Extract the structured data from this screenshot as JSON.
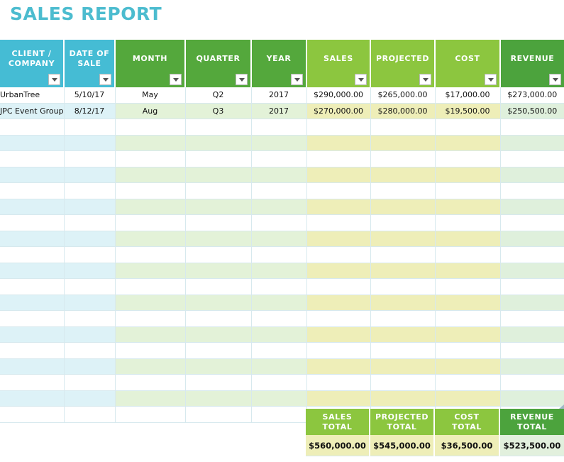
{
  "title": "SALES REPORT",
  "accent_color": "#4cbccf",
  "table": {
    "columns": [
      {
        "label": "CLIENT /\nCOMPANY",
        "line1": "CLIENT /",
        "line2": "COMPANY",
        "color": "#45bcd4"
      },
      {
        "label": "DATE OF\nSALE",
        "line1": "DATE OF",
        "line2": "SALE",
        "color": "#45bcd4"
      },
      {
        "label": "MONTH",
        "line1": "MONTH",
        "line2": "",
        "color": "#54a83c"
      },
      {
        "label": "QUARTER",
        "line1": "QUARTER",
        "line2": "",
        "color": "#54a83c"
      },
      {
        "label": "YEAR",
        "line1": "YEAR",
        "line2": "",
        "color": "#54a83c"
      },
      {
        "label": "SALES",
        "line1": "SALES",
        "line2": "",
        "color": "#8cc63f"
      },
      {
        "label": "PROJECTED",
        "line1": "PROJECTED",
        "line2": "",
        "color": "#8cc63f"
      },
      {
        "label": "COST",
        "line1": "COST",
        "line2": "",
        "color": "#8cc63f"
      },
      {
        "label": "REVENUE",
        "line1": "REVENUE",
        "line2": "",
        "color": "#4ca33d"
      }
    ],
    "filter_icon": "chevron-down-icon",
    "rows": [
      {
        "client": "UrbanTree",
        "date": "5/10/17",
        "month": "May",
        "quarter": "Q2",
        "year": "2017",
        "sales": "$290,000.00",
        "projected": "$265,000.00",
        "cost": "$17,000.00",
        "revenue": "$273,000.00"
      },
      {
        "client": "JPC Event Group",
        "date": "8/12/17",
        "month": "Aug",
        "quarter": "Q3",
        "year": "2017",
        "sales": "$270,000.00",
        "projected": "$280,000.00",
        "cost": "$19,500.00",
        "revenue": "$250,500.00"
      },
      {
        "client": "",
        "date": "",
        "month": "",
        "quarter": "",
        "year": "",
        "sales": "",
        "projected": "",
        "cost": "",
        "revenue": ""
      },
      {
        "client": "",
        "date": "",
        "month": "",
        "quarter": "",
        "year": "",
        "sales": "",
        "projected": "",
        "cost": "",
        "revenue": ""
      },
      {
        "client": "",
        "date": "",
        "month": "",
        "quarter": "",
        "year": "",
        "sales": "",
        "projected": "",
        "cost": "",
        "revenue": ""
      },
      {
        "client": "",
        "date": "",
        "month": "",
        "quarter": "",
        "year": "",
        "sales": "",
        "projected": "",
        "cost": "",
        "revenue": ""
      },
      {
        "client": "",
        "date": "",
        "month": "",
        "quarter": "",
        "year": "",
        "sales": "",
        "projected": "",
        "cost": "",
        "revenue": ""
      },
      {
        "client": "",
        "date": "",
        "month": "",
        "quarter": "",
        "year": "",
        "sales": "",
        "projected": "",
        "cost": "",
        "revenue": ""
      },
      {
        "client": "",
        "date": "",
        "month": "",
        "quarter": "",
        "year": "",
        "sales": "",
        "projected": "",
        "cost": "",
        "revenue": ""
      },
      {
        "client": "",
        "date": "",
        "month": "",
        "quarter": "",
        "year": "",
        "sales": "",
        "projected": "",
        "cost": "",
        "revenue": ""
      },
      {
        "client": "",
        "date": "",
        "month": "",
        "quarter": "",
        "year": "",
        "sales": "",
        "projected": "",
        "cost": "",
        "revenue": ""
      },
      {
        "client": "",
        "date": "",
        "month": "",
        "quarter": "",
        "year": "",
        "sales": "",
        "projected": "",
        "cost": "",
        "revenue": ""
      },
      {
        "client": "",
        "date": "",
        "month": "",
        "quarter": "",
        "year": "",
        "sales": "",
        "projected": "",
        "cost": "",
        "revenue": ""
      },
      {
        "client": "",
        "date": "",
        "month": "",
        "quarter": "",
        "year": "",
        "sales": "",
        "projected": "",
        "cost": "",
        "revenue": ""
      },
      {
        "client": "",
        "date": "",
        "month": "",
        "quarter": "",
        "year": "",
        "sales": "",
        "projected": "",
        "cost": "",
        "revenue": ""
      },
      {
        "client": "",
        "date": "",
        "month": "",
        "quarter": "",
        "year": "",
        "sales": "",
        "projected": "",
        "cost": "",
        "revenue": ""
      },
      {
        "client": "",
        "date": "",
        "month": "",
        "quarter": "",
        "year": "",
        "sales": "",
        "projected": "",
        "cost": "",
        "revenue": ""
      },
      {
        "client": "",
        "date": "",
        "month": "",
        "quarter": "",
        "year": "",
        "sales": "",
        "projected": "",
        "cost": "",
        "revenue": ""
      },
      {
        "client": "",
        "date": "",
        "month": "",
        "quarter": "",
        "year": "",
        "sales": "",
        "projected": "",
        "cost": "",
        "revenue": ""
      },
      {
        "client": "",
        "date": "",
        "month": "",
        "quarter": "",
        "year": "",
        "sales": "",
        "projected": "",
        "cost": "",
        "revenue": ""
      },
      {
        "client": "",
        "date": "",
        "month": "",
        "quarter": "",
        "year": "",
        "sales": "",
        "projected": "",
        "cost": "",
        "revenue": ""
      }
    ]
  },
  "totals": {
    "headers": [
      {
        "line1": "SALES",
        "line2": "TOTAL",
        "color": "#8cc63f"
      },
      {
        "line1": "PROJECTED",
        "line2": "TOTAL",
        "color": "#8cc63f"
      },
      {
        "line1": "COST",
        "line2": "TOTAL",
        "color": "#8cc63f"
      },
      {
        "line1": "REVENUE",
        "line2": "TOTAL",
        "color": "#4ca33d"
      }
    ],
    "values": {
      "sales_total": "$560,000.00",
      "projected_total": "$545,000.00",
      "cost_total": "$36,500.00",
      "revenue_total": "$523,500.00"
    }
  }
}
